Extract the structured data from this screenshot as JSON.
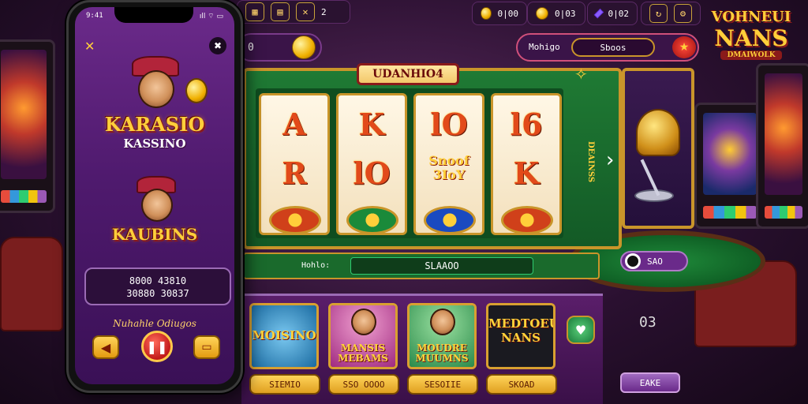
{
  "hud": {
    "small_count": "2",
    "coin_a": "0|00",
    "coin_b": "0|03",
    "gems": "0|02",
    "promo_value": "0",
    "spin_label": "Mohigo",
    "spin_value": "Sboos"
  },
  "phone": {
    "status_time": "9:41",
    "status_icons": "ıll ⌔ ▭",
    "logo_top": "KARASIO",
    "logo_sub": "KASSINO",
    "logo_bottom": "KAUBINS",
    "balance_line1": "8000 43810",
    "balance_line2": "30880 30837",
    "subtitle": "Nuhahle Odiugos"
  },
  "machine": {
    "title": "UDANHIO4",
    "side_label": "DEAINSS",
    "reels": [
      {
        "top": "A",
        "mid": "R"
      },
      {
        "top": "K",
        "mid": "lO"
      },
      {
        "top": "lO",
        "mid": "Snoof 3IoY"
      },
      {
        "top": "l6",
        "mid": "K"
      }
    ],
    "bar_label": "Hohlo:",
    "bar_value": "SLAAOO"
  },
  "table": {
    "chip_label": "SAO",
    "counter": "03",
    "save_label": "EAKE"
  },
  "cards": [
    {
      "title": "MOISINO",
      "button": "SIEMIO",
      "bg": "#3aa0d8"
    },
    {
      "title": "MANSIS MEBAMS",
      "button": "SSO OOOO",
      "bg": "#e06ab0"
    },
    {
      "title": "MOUDRE MUUMNS",
      "button": "SESOIIE",
      "bg": "#4ab86a"
    },
    {
      "title": "MEDTOEU NANS",
      "button": "SKOAD",
      "bg": "#1a1a20"
    }
  ],
  "right_logo": {
    "line1": "VOHNEUI",
    "line2": "NANS",
    "sub": "DMAIWOLK"
  },
  "colors": {
    "gold": "#c9952a",
    "felt": "#1f7a34",
    "purple": "#5a1e6a"
  }
}
